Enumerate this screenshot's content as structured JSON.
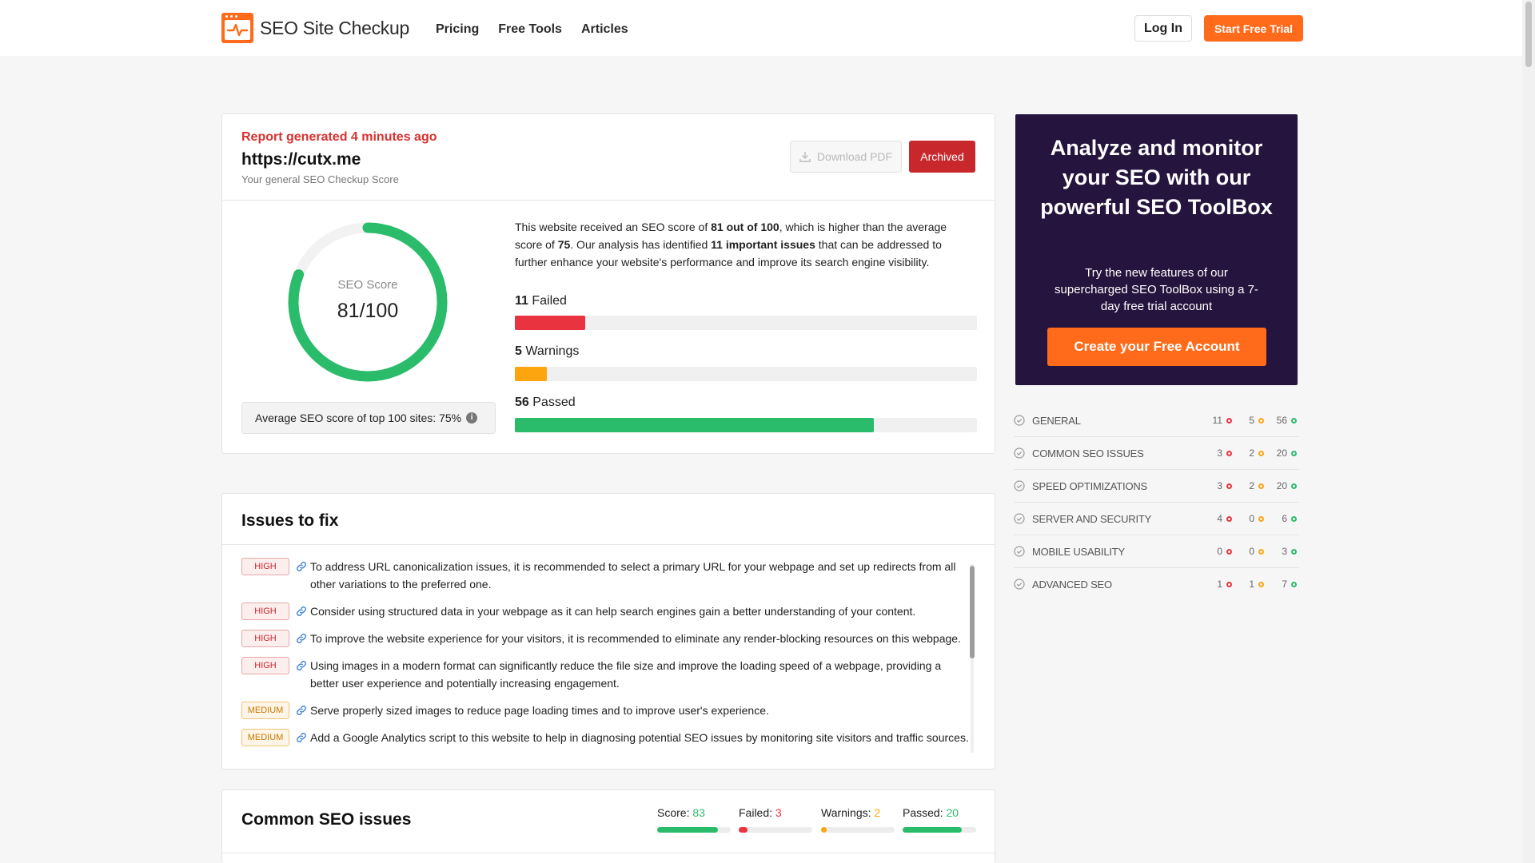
{
  "header": {
    "logo_text": "SEO Site Checkup",
    "nav": [
      "Pricing",
      "Free Tools",
      "Articles"
    ],
    "login": "Log In",
    "trial": "Start Free Trial"
  },
  "report": {
    "generated": "Report generated 4 minutes ago",
    "url": "https://cutx.me",
    "subtitle": "Your general SEO Checkup Score",
    "download_pdf": "Download PDF",
    "archived": "Archived",
    "score_label": "SEO Score",
    "score_value": "81/100",
    "score_fraction": 0.81,
    "avg_text": "Average SEO score of top 100 sites: 75%",
    "info_icon": "i",
    "summary": {
      "p1": "This website received an SEO score of ",
      "b1": "81 out of 100",
      "p2": ", which is higher than the average score of ",
      "b2": "75",
      "p3": ". Our analysis has identified ",
      "b3": "11 important issues",
      "p4": " that can be addressed to further enhance your website's performance and improve its search engine visibility."
    },
    "stats": [
      {
        "count": "11",
        "label": "Failed",
        "fraction": 0.153,
        "color": "#e9333f"
      },
      {
        "count": "5",
        "label": "Warnings",
        "fraction": 0.07,
        "color": "#fda50f"
      },
      {
        "count": "56",
        "label": "Passed",
        "fraction": 0.777,
        "color": "#2abc6a"
      }
    ]
  },
  "issues": {
    "title": "Issues to fix",
    "items": [
      {
        "level": "HIGH",
        "text": "To address URL canonicalization issues, it is recommended to select a primary URL for your webpage and set up redirects from all other variations to the preferred one."
      },
      {
        "level": "HIGH",
        "text": "Consider using structured data in your webpage as it can help search engines gain a better understanding of your content."
      },
      {
        "level": "HIGH",
        "text": "To improve the website experience for your visitors, it is recommended to eliminate any render-blocking resources on this webpage."
      },
      {
        "level": "HIGH",
        "text": "Using images in a modern format can significantly reduce the file size and improve the loading speed of a webpage, providing a better user experience and potentially increasing engagement."
      },
      {
        "level": "MEDIUM",
        "text": "Serve properly sized images to reduce page loading times and to improve user's experience."
      },
      {
        "level": "MEDIUM",
        "text": "Add a Google Analytics script to this website to help in diagnosing potential SEO issues by monitoring site visitors and traffic sources."
      }
    ]
  },
  "common": {
    "title": "Common SEO issues",
    "stats": [
      {
        "label": "Score: ",
        "value": "83",
        "fraction": 0.83,
        "color": "#2abc6a"
      },
      {
        "label": "Failed: ",
        "value": "3",
        "fraction": 0.12,
        "color": "#e9333f"
      },
      {
        "label": "Warnings: ",
        "value": "2",
        "fraction": 0.08,
        "color": "#fda50f"
      },
      {
        "label": "Passed: ",
        "value": "20",
        "fraction": 0.8,
        "color": "#2abc6a"
      }
    ]
  },
  "promo": {
    "title": "Analyze and monitor your SEO with our powerful SEO ToolBox",
    "text": "Try the new features of our supercharged SEO ToolBox using a 7-day free trial account",
    "button": "Create your Free Account"
  },
  "categories": [
    {
      "name": "GENERAL",
      "failed": "11",
      "warnings": "5",
      "passed": "56"
    },
    {
      "name": "COMMON SEO ISSUES",
      "failed": "3",
      "warnings": "2",
      "passed": "20"
    },
    {
      "name": "SPEED OPTIMIZATIONS",
      "failed": "3",
      "warnings": "2",
      "passed": "20"
    },
    {
      "name": "SERVER AND SECURITY",
      "failed": "4",
      "warnings": "0",
      "passed": "6"
    },
    {
      "name": "MOBILE USABILITY",
      "failed": "0",
      "warnings": "0",
      "passed": "3"
    },
    {
      "name": "ADVANCED SEO",
      "failed": "1",
      "warnings": "1",
      "passed": "7"
    }
  ],
  "colors": {
    "accent": "#ff6b1a",
    "fail": "#e9333f",
    "warn": "#fda50f",
    "pass": "#2abc6a",
    "promo_bg": "#25143d",
    "archived": "#c8282c"
  }
}
